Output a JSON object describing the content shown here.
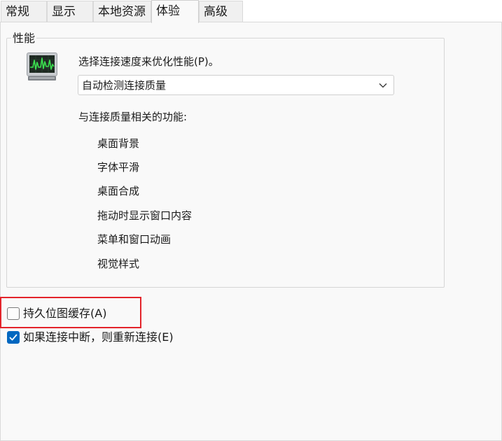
{
  "tabs": [
    {
      "label": "常规",
      "active": false
    },
    {
      "label": "显示",
      "active": false
    },
    {
      "label": "本地资源",
      "active": false
    },
    {
      "label": "体验",
      "active": true
    },
    {
      "label": "高级",
      "active": false
    }
  ],
  "performance": {
    "group_title": "性能",
    "prompt": "选择连接速度来优化性能(P)。",
    "speed_select": {
      "value": "自动检测连接质量"
    },
    "features_heading": "与连接质量相关的功能:",
    "features": [
      "桌面背景",
      "字体平滑",
      "桌面合成",
      "拖动时显示窗口内容",
      "菜单和窗口动画",
      "视觉样式"
    ]
  },
  "options": {
    "persistent_bitmap": {
      "label": "持久位图缓存(A)",
      "checked": false
    },
    "reconnect": {
      "label": "如果连接中断，则重新连接(E)",
      "checked": true
    }
  },
  "colors": {
    "accent": "#0067c0",
    "highlight": "#e3242b",
    "monitor_screen": "#1e2a22",
    "monitor_trace": "#3be04f"
  },
  "icons": {
    "monitor": "performance-monitor-icon",
    "chevron": "chevron-down-icon",
    "check": "checkmark-icon"
  }
}
